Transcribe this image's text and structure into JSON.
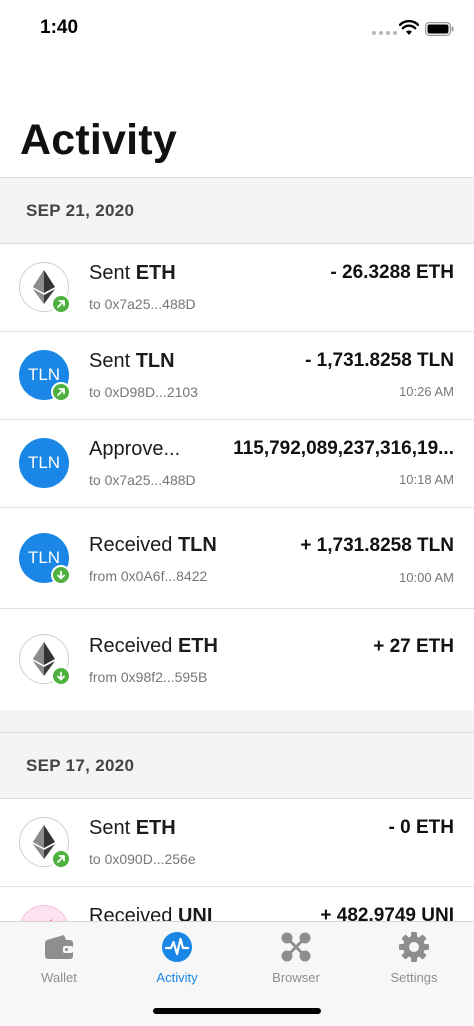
{
  "status_bar": {
    "time": "1:40"
  },
  "page": {
    "title": "Activity"
  },
  "sections": [
    {
      "date": "SEP 21, 2020",
      "transactions": [
        {
          "action": "Sent",
          "token": "ETH",
          "address": "to 0x7a25...488D",
          "amount": "- 26.3288 ETH",
          "time": ""
        },
        {
          "action": "Sent",
          "token": "TLN",
          "address": "to 0xD98D...2103",
          "amount": "- 1,731.8258 TLN",
          "time": "10:26 AM"
        },
        {
          "action": "Approve...",
          "token": "",
          "address": "to 0x7a25...488D",
          "amount": "115,792,089,237,316,19...",
          "time": "10:18 AM"
        },
        {
          "action": "Received",
          "token": "TLN",
          "address": "from 0x0A6f...8422",
          "amount": "+ 1,731.8258 TLN",
          "time": "10:00 AM"
        },
        {
          "action": "Received",
          "token": "ETH",
          "address": "from 0x98f2...595B",
          "amount": "+ 27 ETH",
          "time": ""
        }
      ]
    },
    {
      "date": "SEP 17, 2020",
      "transactions": [
        {
          "action": "Sent",
          "token": "ETH",
          "address": "to 0x090D...256e",
          "amount": "- 0 ETH",
          "time": ""
        },
        {
          "action": "Received",
          "token": "UNI",
          "address": "",
          "amount": "+ 482.9749 UNI",
          "time": ""
        }
      ]
    }
  ],
  "token_avatars": {
    "tln_label": "TLN"
  },
  "tab_bar": {
    "tabs": [
      {
        "label": "Wallet",
        "icon": "wallet-icon",
        "active": false
      },
      {
        "label": "Activity",
        "icon": "activity-icon",
        "active": true
      },
      {
        "label": "Browser",
        "icon": "browser-icon",
        "active": false
      },
      {
        "label": "Settings",
        "icon": "gear-icon",
        "active": false
      }
    ]
  },
  "colors": {
    "accent": "#1a87e6",
    "badge_green": "#4eb03d",
    "section_bg": "#f4f4f4",
    "tab_inactive": "#8e8e8e"
  }
}
